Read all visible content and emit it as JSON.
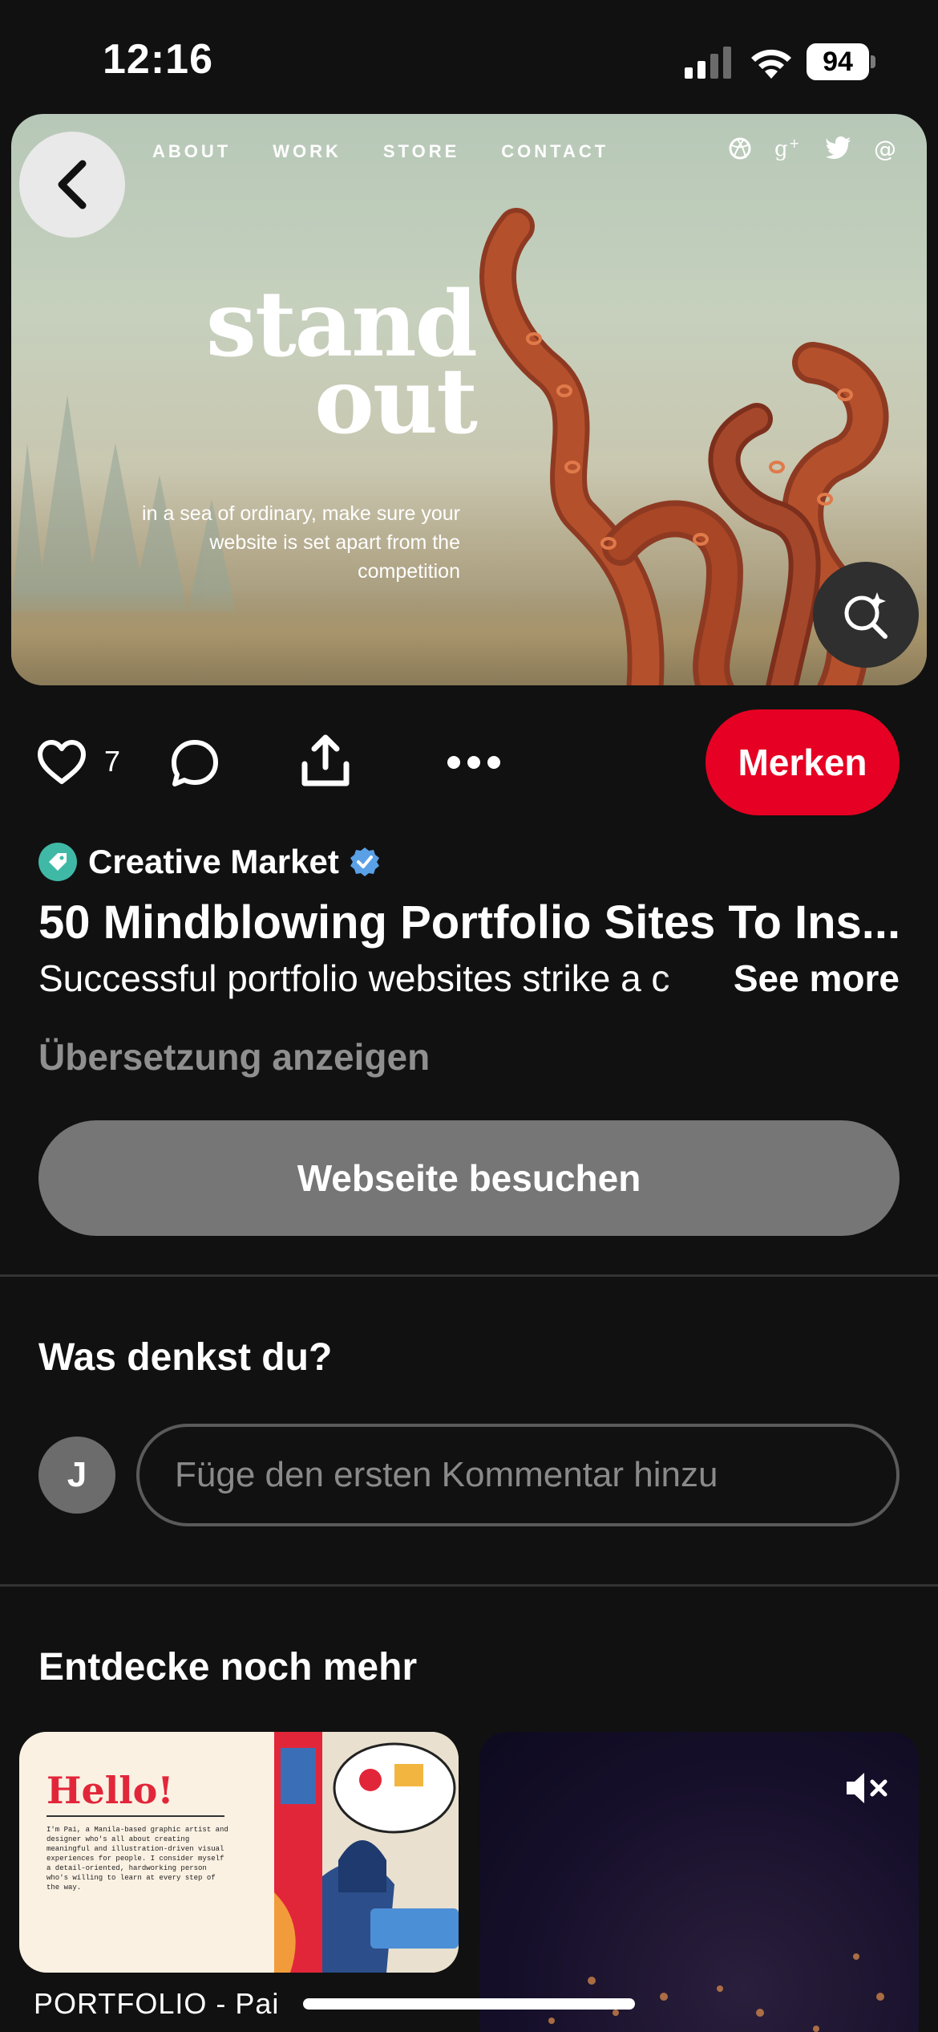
{
  "status_bar": {
    "time": "12:16",
    "battery": "94"
  },
  "hero": {
    "nav": [
      "ABOUT",
      "WORK",
      "STORE",
      "CONTACT"
    ],
    "headline_line1": "stand",
    "headline_line2": "out",
    "subtext": "in a sea of ordinary, make sure your website is set apart from the competition",
    "social_icons": [
      "dribbble-icon",
      "google-plus-icon",
      "twitter-icon",
      "at-icon"
    ]
  },
  "actions": {
    "like_count": "7",
    "save_label": "Merken"
  },
  "pin": {
    "source_name": "Creative Market",
    "title": "50 Mindblowing Portfolio Sites To Ins...",
    "description": "Successful portfolio websites strike a c",
    "see_more": "See more",
    "translate_label": "Übersetzung anzeigen",
    "visit_label": "Webseite besuchen"
  },
  "comments": {
    "heading": "Was denkst du?",
    "avatar_initial": "J",
    "placeholder": "Füge den ersten Kommentar hinzu"
  },
  "more": {
    "heading": "Entdecke noch mehr",
    "card1": {
      "hello": "Hello!",
      "text": "I'm Pai, a Manila-based graphic artist and designer who's all about creating meaningful and illustration-driven visual experiences for people. I consider myself a detail-oriented, hardworking person who's willing to learn at every step of the way.",
      "title": "PORTFOLIO - Pai"
    }
  },
  "colors": {
    "background": "#111111",
    "save": "#e60023",
    "visit": "#767676",
    "verified": "#5aa0e6"
  }
}
